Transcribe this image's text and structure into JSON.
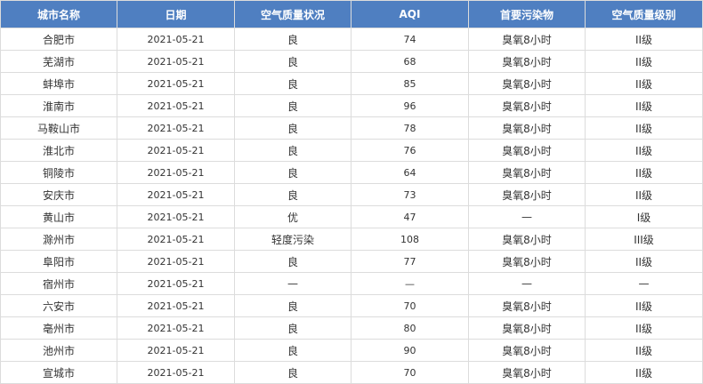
{
  "table": {
    "columns": [
      "城市名称",
      "日期",
      "空气质量状况",
      "AQI",
      "首要污染物",
      "空气质量级别"
    ],
    "rows": [
      {
        "city": "合肥市",
        "date": "2021-05-21",
        "status": "良",
        "aqi": "74",
        "pollutant": "臭氧8小时",
        "level": "II级"
      },
      {
        "city": "芜湖市",
        "date": "2021-05-21",
        "status": "良",
        "aqi": "68",
        "pollutant": "臭氧8小时",
        "level": "II级"
      },
      {
        "city": "蚌埠市",
        "date": "2021-05-21",
        "status": "良",
        "aqi": "85",
        "pollutant": "臭氧8小时",
        "level": "II级"
      },
      {
        "city": "淮南市",
        "date": "2021-05-21",
        "status": "良",
        "aqi": "96",
        "pollutant": "臭氧8小时",
        "level": "II级"
      },
      {
        "city": "马鞍山市",
        "date": "2021-05-21",
        "status": "良",
        "aqi": "78",
        "pollutant": "臭氧8小时",
        "level": "II级"
      },
      {
        "city": "淮北市",
        "date": "2021-05-21",
        "status": "良",
        "aqi": "76",
        "pollutant": "臭氧8小时",
        "level": "II级"
      },
      {
        "city": "铜陵市",
        "date": "2021-05-21",
        "status": "良",
        "aqi": "64",
        "pollutant": "臭氧8小时",
        "level": "II级"
      },
      {
        "city": "安庆市",
        "date": "2021-05-21",
        "status": "良",
        "aqi": "73",
        "pollutant": "臭氧8小时",
        "level": "II级"
      },
      {
        "city": "黄山市",
        "date": "2021-05-21",
        "status": "优",
        "aqi": "47",
        "pollutant": "—",
        "level": "I级"
      },
      {
        "city": "滁州市",
        "date": "2021-05-21",
        "status": "轻度污染",
        "aqi": "108",
        "pollutant": "臭氧8小时",
        "level": "III级"
      },
      {
        "city": "阜阳市",
        "date": "2021-05-21",
        "status": "良",
        "aqi": "77",
        "pollutant": "臭氧8小时",
        "level": "II级"
      },
      {
        "city": "宿州市",
        "date": "2021-05-21",
        "status": "—",
        "aqi": "—",
        "pollutant": "—",
        "level": "—"
      },
      {
        "city": "六安市",
        "date": "2021-05-21",
        "status": "良",
        "aqi": "70",
        "pollutant": "臭氧8小时",
        "level": "II级"
      },
      {
        "city": "亳州市",
        "date": "2021-05-21",
        "status": "良",
        "aqi": "80",
        "pollutant": "臭氧8小时",
        "level": "II级"
      },
      {
        "city": "池州市",
        "date": "2021-05-21",
        "status": "良",
        "aqi": "90",
        "pollutant": "臭氧8小时",
        "level": "II级"
      },
      {
        "city": "宣城市",
        "date": "2021-05-21",
        "status": "良",
        "aqi": "70",
        "pollutant": "臭氧8小时",
        "level": "II级"
      }
    ]
  }
}
